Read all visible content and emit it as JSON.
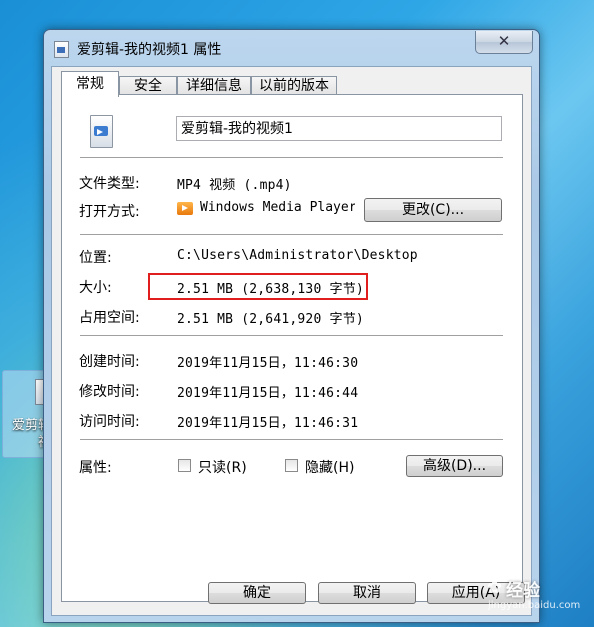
{
  "window": {
    "title": "爱剪辑-我的视频1 属性",
    "close_glyph": "✕"
  },
  "tabs": [
    "常规",
    "安全",
    "详细信息",
    "以前的版本"
  ],
  "general": {
    "file_name": "爱剪辑-我的视频1",
    "file_type_label": "文件类型:",
    "file_type_value": "MP4 视频 (.mp4)",
    "open_with_label": "打开方式:",
    "open_with_app": "Windows Media Player",
    "change_button": "更改(C)...",
    "location_label": "位置:",
    "location_value": "C:\\Users\\Administrator\\Desktop",
    "size_label": "大小:",
    "size_value": "2.51 MB (2,638,130 字节)",
    "size_on_disk_label": "占用空间:",
    "size_on_disk_value": "2.51 MB (2,641,920 字节)",
    "created_label": "创建时间:",
    "created_value": "2019年11月15日，11:46:30",
    "modified_label": "修改时间:",
    "modified_value": "2019年11月15日，11:46:44",
    "accessed_label": "访问时间:",
    "accessed_value": "2019年11月15日，11:46:31",
    "attributes_label": "属性:",
    "readonly_label": "只读(R)",
    "hidden_label": "隐藏(H)",
    "advanced_button": "高级(D)..."
  },
  "footer": {
    "ok": "确定",
    "cancel": "取消",
    "apply": "应用(A)"
  },
  "desktop": {
    "icon_label_line1": "爱剪辑",
    "icon_label_line2": "视"
  },
  "watermark": {
    "text": "经验",
    "sub": "jingyan.baidu.com",
    "paw_glyph": "✿"
  },
  "colors": {
    "highlight_box": "#e01e1e",
    "title_bar": "#b8d3ec",
    "desktop": "#2ea6e6"
  }
}
